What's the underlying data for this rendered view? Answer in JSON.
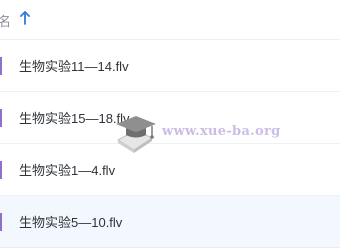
{
  "header": {
    "column_label": "名",
    "sort_icon": "sort-ascending-arrow-icon",
    "accent_color": "#2e7ad4"
  },
  "files": [
    {
      "name": "生物实验11—14.flv",
      "selected": false
    },
    {
      "name": "生物实验15—18.flv",
      "selected": false
    },
    {
      "name": "生物实验1—4.flv",
      "selected": false
    },
    {
      "name": "生物实验5—10.flv",
      "selected": true
    }
  ],
  "watermark": {
    "text": "www.xue-ba.org",
    "icon": "graduation-cap-book-icon"
  },
  "colors": {
    "row_marker": "#8e72c9",
    "selected_row_bg": "#f3f8fe",
    "watermark_text": "#b9a7de"
  }
}
